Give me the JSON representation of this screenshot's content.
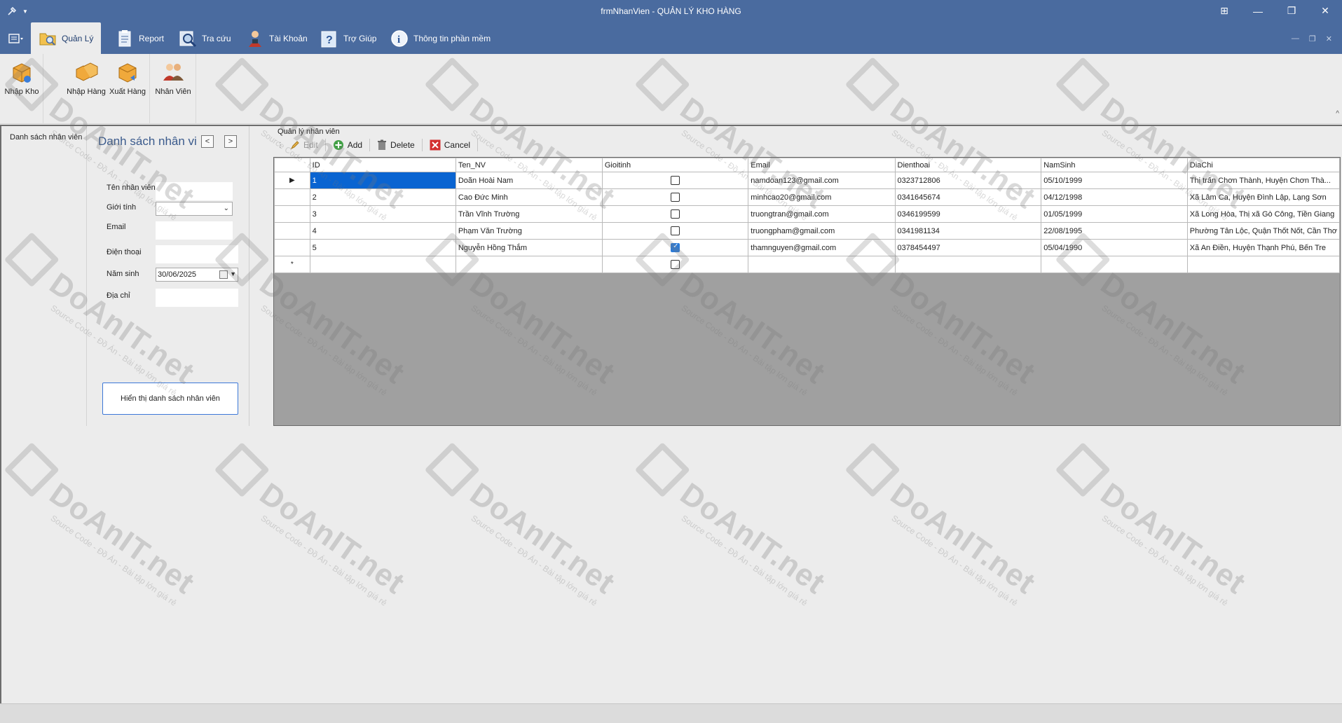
{
  "window": {
    "title": "frmNhanVien - QUẢN LÝ KHO HÀNG"
  },
  "ribbon_tabs": [
    {
      "label": "Quản Lý",
      "icon": "folder-search-icon",
      "active": true
    },
    {
      "label": "Report",
      "icon": "clipboard-icon",
      "active": false
    },
    {
      "label": "Tra cứu",
      "icon": "magnifier-icon",
      "active": false
    },
    {
      "label": "Tài Khoản",
      "icon": "user-account-icon",
      "active": false
    },
    {
      "label": "Trợ Giúp",
      "icon": "help-book-icon",
      "active": false
    },
    {
      "label": "Thông tin phần mềm",
      "icon": "info-icon",
      "active": false
    }
  ],
  "ribbon_buttons": {
    "nhap_kho": "Nhập Kho",
    "nhap_hang": "Nhập Hàng",
    "xuat_hang": "Xuất Hàng",
    "nhan_vien": "Nhân Viên"
  },
  "left_nav": {
    "label": "Danh sách nhân viên"
  },
  "form": {
    "title": "Danh sách nhân viê",
    "labels": {
      "ten": "Tên nhân viên",
      "gioitinh": "Giới tính",
      "email": "Email",
      "dienthoai": "Điện thoại",
      "namsinh": "Năm sinh",
      "diachi": "Địa chỉ"
    },
    "values": {
      "ten": "",
      "gioitinh": "",
      "email": "",
      "dienthoai": "",
      "namsinh": "30/06/2025",
      "diachi": ""
    },
    "show_button": "Hiển thị danh sách nhân viên"
  },
  "manager": {
    "caption": "Quản lý nhân viên",
    "toolbar": {
      "edit": "Edit",
      "add": "Add",
      "delete": "Delete",
      "cancel": "Cancel"
    }
  },
  "grid": {
    "columns": [
      "ID",
      "Ten_NV",
      "Gioitinh",
      "Email",
      "Dienthoai",
      "NamSinh",
      "DiaChi"
    ],
    "rows": [
      {
        "id": "1",
        "ten": "Doãn Hoài Nam",
        "gioitinh": false,
        "email": "namdoan123@gmail.com",
        "dienthoai": "0323712806",
        "namsinh": "05/10/1999",
        "diachi": "Thị trấn Chơn Thành, Huyện Chơn Thà..."
      },
      {
        "id": "2",
        "ten": "Cao Đức Minh",
        "gioitinh": false,
        "email": "minhcao20@gmail.com",
        "dienthoai": "0341645674",
        "namsinh": "04/12/1998",
        "diachi": "Xã Lâm Ca, Huyện Đình Lập, Lạng Sơn"
      },
      {
        "id": "3",
        "ten": "Trần Vĩnh Trường",
        "gioitinh": false,
        "email": "truongtran@gmail.com",
        "dienthoai": "0346199599",
        "namsinh": "01/05/1999",
        "diachi": "Xã Long Hòa, Thị xã Gò Công, Tiền Giang"
      },
      {
        "id": "4",
        "ten": "Phạm Văn Trường",
        "gioitinh": false,
        "email": "truongpham@gmail.com",
        "dienthoai": "0341981134",
        "namsinh": "22/08/1995",
        "diachi": "Phường Tân Lộc, Quận Thốt Nốt, Cần Thơ"
      },
      {
        "id": "5",
        "ten": "Nguyễn Hồng Thắm",
        "gioitinh": true,
        "email": "thamnguyen@gmail.com",
        "dienthoai": "0378454497",
        "namsinh": "05/04/1990",
        "diachi": "Xã An Điền, Huyện Thạnh Phú, Bến Tre"
      }
    ]
  },
  "watermark": {
    "brand": "DoAnIT.net",
    "tagline": "Source Code - Đồ Án - Bài tập lớn giá rẻ"
  }
}
